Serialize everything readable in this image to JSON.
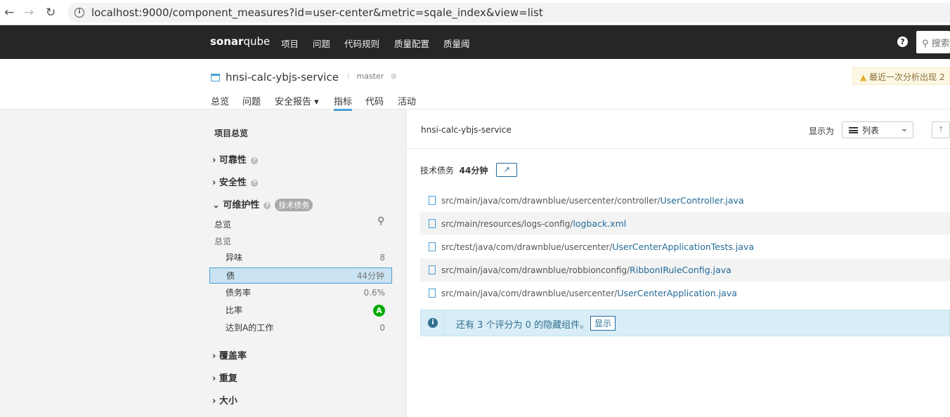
{
  "browser": {
    "url": "localhost:9000/component_measures?id=user-center&metric=sqale_index&view=list"
  },
  "nav": {
    "logo_bold": "sonar",
    "logo_rest": "qube",
    "items": [
      "项目",
      "问题",
      "代码规则",
      "质量配置",
      "质量阈"
    ],
    "search_placeholder": "搜索"
  },
  "project": {
    "name": "hnsi-calc-ybjs-service",
    "branch": "master",
    "warning": "最近一次分析出现 2",
    "tabs": [
      "总览",
      "问题",
      "安全报告 ▾",
      "指标",
      "代码",
      "活动"
    ],
    "active_tab": "指标"
  },
  "sidebar": {
    "title": "项目总览",
    "groups": {
      "reliability": "可靠性",
      "security": "安全性",
      "maintainability": "可维护性",
      "maint_badge": "技术债务",
      "coverage": "覆盖率",
      "duplication": "重复",
      "size": "大小"
    },
    "overview1": "总览",
    "overview2": "总览",
    "metrics": [
      {
        "label": "异味",
        "value": "8"
      },
      {
        "label": "债",
        "value": "44分钟"
      },
      {
        "label": "债务率",
        "value": "0.6%"
      },
      {
        "label": "比率",
        "value": "A"
      },
      {
        "label": "达到A的工作",
        "value": "0"
      }
    ]
  },
  "main": {
    "breadcrumb": "hnsi-calc-ybjs-service",
    "view_label": "显示为",
    "view_value": "列表",
    "up": "↑",
    "metric_label": "技术债务",
    "metric_value": "44分钟",
    "files": [
      {
        "path": "src/main/java/com/drawnblue/usercenter/controller/",
        "name": "UserController.java"
      },
      {
        "path": "src/main/resources/logs-config/",
        "name": "logback.xml"
      },
      {
        "path": "src/test/java/com/drawnblue/usercenter/",
        "name": "UserCenterApplicationTests.java"
      },
      {
        "path": "src/main/java/com/drawnblue/robbionconfig/",
        "name": "RibbonIRuleConfig.java"
      },
      {
        "path": "src/main/java/com/drawnblue/usercenter/",
        "name": "UserCenterApplication.java"
      }
    ],
    "notice": "还有 3 个评分为 0 的隐藏组件。",
    "notice_button": "显示"
  },
  "colors": {
    "accent": "#4b9fd5",
    "nav_bg": "#262626",
    "rating_a": "#00aa00"
  }
}
